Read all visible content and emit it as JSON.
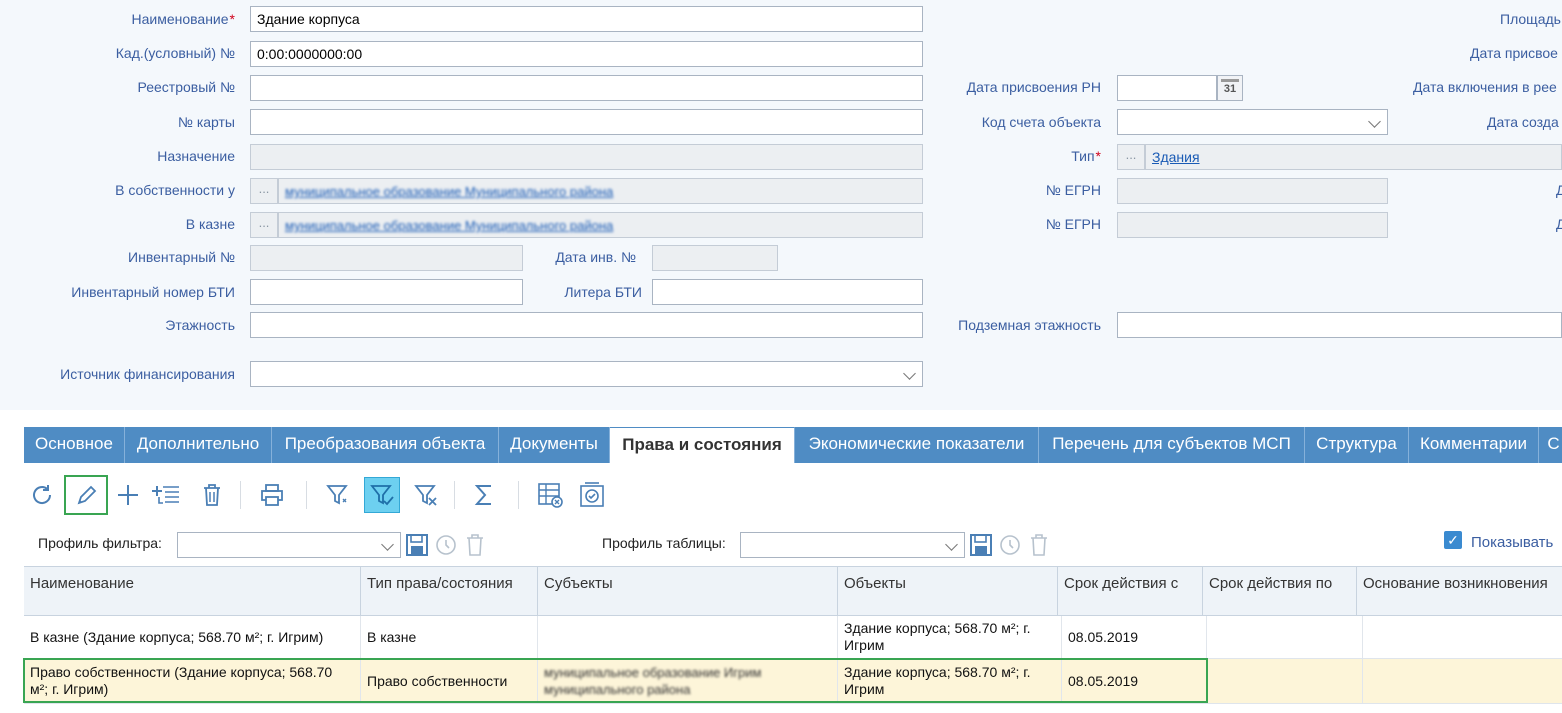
{
  "form": {
    "name_label": "Наименование",
    "name_value": "Здание корпуса",
    "cad_label": "Кад.(условный) №",
    "cad_value": "0:00:0000000:00",
    "reg_label": "Реестровый №",
    "card_label": "№ карты",
    "purpose_label": "Назначение",
    "owner_label": "В собственности у",
    "owner_value": "муниципальное образование Муниципального района",
    "treasury_label": "В казне",
    "treasury_value": "муниципальное образование Муниципального района",
    "inv_label": "Инвентарный №",
    "inv_date_label": "Дата инв. №",
    "bti_inv_label": "Инвентарный номер БТИ",
    "bti_letter_label": "Литера БТИ",
    "floors_label": "Этажность",
    "underground_label": "Подземная этажность",
    "funding_label": "Источник финансирования",
    "rn_date_label": "Дата присвоения РН",
    "calendar_icon_text": "31",
    "account_label": "Код счета объекта",
    "type_label": "Тип",
    "type_value": "Здания",
    "egrn_label_1": "№ ЕГРН",
    "egrn_label_2": "№ ЕГРН",
    "right_area": "Площадь",
    "right_assign": "Дата присвое",
    "right_include": "Дата включения в рее",
    "right_create": "Дата созда",
    "right_d1": "Д",
    "right_d2": "Д",
    "picker_dots": "..."
  },
  "tabs": [
    {
      "label": "Основное"
    },
    {
      "label": "Дополнительно"
    },
    {
      "label": "Преобразования объекта"
    },
    {
      "label": "Документы"
    },
    {
      "label": "Права и состояния"
    },
    {
      "label": "Экономические показатели"
    },
    {
      "label": "Перечень для субъектов МСП"
    },
    {
      "label": "Структура"
    },
    {
      "label": "Комментарии"
    },
    {
      "label": "С"
    }
  ],
  "profiles": {
    "filter_label": "Профиль фильтра:",
    "table_label": "Профиль таблицы:",
    "show_label": "Показывать"
  },
  "grid": {
    "headers": [
      "Наименование",
      "Тип права/состояния",
      "Субъекты",
      "Объекты",
      "Срок действия с",
      "Срок действия по",
      "Основание возникновения"
    ],
    "rows": [
      {
        "name": "В казне (Здание корпуса; 568.70 м²; г. Игрим)",
        "type": "В казне",
        "subjects": "",
        "objects": "Здание корпуса; 568.70 м²; г. Игрим",
        "from": "08.05.2019",
        "to": "",
        "basis": ""
      },
      {
        "name": "Право собственности (Здание корпуса; 568.70 м²; г. Игрим)",
        "type": "Право собственности",
        "subjects": "муниципальное образование Игрим муниципального района",
        "objects": "Здание корпуса; 568.70 м²; г. Игрим",
        "from": "08.05.2019",
        "to": "",
        "basis": ""
      }
    ]
  },
  "colors": {
    "tab_bar": "#4f8cc4",
    "label": "#3b5ea1",
    "selected_row": "#fdf5d9",
    "highlight": "#39a552"
  }
}
